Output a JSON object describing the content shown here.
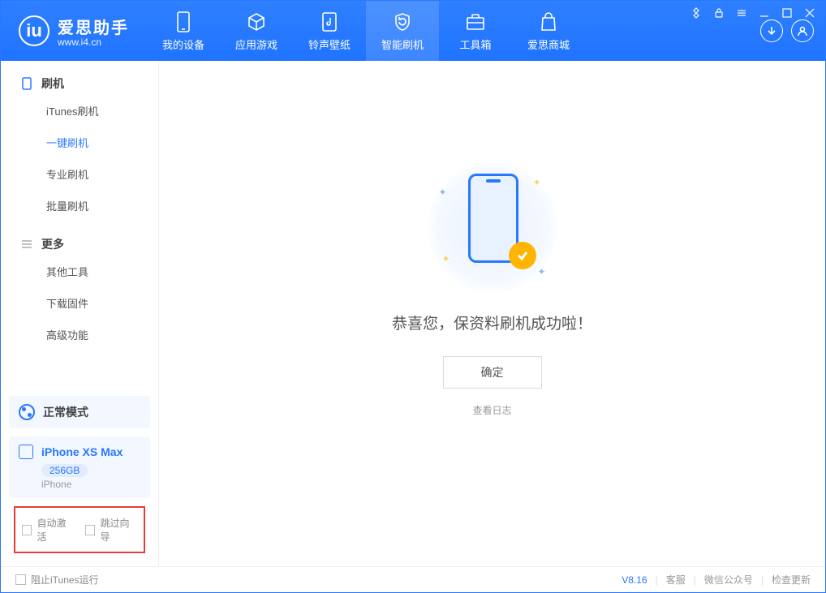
{
  "brand": {
    "name": "爱思助手",
    "url": "www.i4.cn",
    "glyph": "iu"
  },
  "nav": [
    {
      "label": "我的设备"
    },
    {
      "label": "应用游戏"
    },
    {
      "label": "铃声壁纸"
    },
    {
      "label": "智能刷机"
    },
    {
      "label": "工具箱"
    },
    {
      "label": "爱思商城"
    }
  ],
  "sidebar": {
    "group1": {
      "title": "刷机",
      "items": [
        {
          "label": "iTunes刷机"
        },
        {
          "label": "一键刷机"
        },
        {
          "label": "专业刷机"
        },
        {
          "label": "批量刷机"
        }
      ]
    },
    "group2": {
      "title": "更多",
      "items": [
        {
          "label": "其他工具"
        },
        {
          "label": "下载固件"
        },
        {
          "label": "高级功能"
        }
      ]
    },
    "mode": "正常模式",
    "device": {
      "name": "iPhone XS Max",
      "capacity": "256GB",
      "type": "iPhone"
    },
    "opts": {
      "auto_activate": "自动激活",
      "skip_guide": "跳过向导"
    }
  },
  "main": {
    "message": "恭喜您，保资料刷机成功啦！",
    "ok": "确定",
    "log": "查看日志"
  },
  "footer": {
    "block_itunes": "阻止iTunes运行",
    "version": "V8.16",
    "links": [
      "客服",
      "微信公众号",
      "检查更新"
    ]
  }
}
